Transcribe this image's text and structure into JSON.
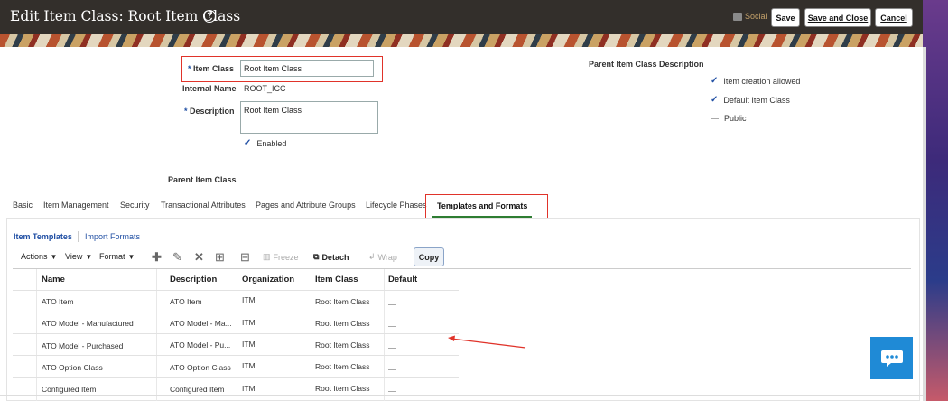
{
  "header": {
    "title": "Edit Item Class: Root Item Class",
    "help_icon": "?",
    "social_label": "Social",
    "buttons": {
      "save": "Save",
      "save_and_close": "Save and Close",
      "cancel": "Cancel"
    }
  },
  "form": {
    "item_class_label": "Item Class",
    "item_class_value": "Root Item Class",
    "internal_name_label": "Internal Name",
    "internal_name_value": "ROOT_ICC",
    "description_label": "Description",
    "description_value": "Root Item Class",
    "enabled_label": "Enabled",
    "parent_item_class_label": "Parent Item Class",
    "required_marker": "*"
  },
  "right_panel": {
    "parent_desc_label": "Parent Item Class Description",
    "options": [
      {
        "label": "Item creation allowed",
        "state": "checked"
      },
      {
        "label": "Default Item Class",
        "state": "checked"
      },
      {
        "label": "Public",
        "state": "unchecked"
      }
    ]
  },
  "tabs": [
    {
      "label": "Basic"
    },
    {
      "label": "Item Management"
    },
    {
      "label": "Security"
    },
    {
      "label": "Transactional Attributes"
    },
    {
      "label": "Pages and Attribute Groups"
    },
    {
      "label": "Lifecycle Phases"
    },
    {
      "label": "Templates and Formats"
    }
  ],
  "active_tab": "Templates and Formats",
  "subtabs": [
    {
      "label": "Item Templates"
    },
    {
      "label": "Import Formats"
    }
  ],
  "toolbar": {
    "actions": "Actions",
    "view": "View",
    "format": "Format",
    "freeze": "Freeze",
    "detach": "Detach",
    "wrap": "Wrap",
    "copy": "Copy"
  },
  "table": {
    "columns": [
      "Name",
      "Description",
      "Organization",
      "Item Class",
      "Default"
    ],
    "rows": [
      [
        "ATO Item",
        "ATO Item",
        "ITM",
        "Root Item Class"
      ],
      [
        "ATO Model - Manufactured",
        "ATO Model - Ma...",
        "ITM",
        "Root Item Class"
      ],
      [
        "ATO Model - Purchased",
        "ATO Model - Pu...",
        "ITM",
        "Root Item Class"
      ],
      [
        "ATO Option Class",
        "ATO Option Class",
        "ITM",
        "Root Item Class"
      ],
      [
        "Configured Item",
        "Configured Item",
        "ITM",
        "Root Item Class"
      ]
    ]
  },
  "colors": {
    "header_bg": "#332f2b",
    "accent_blue": "#1f4ea3",
    "highlight_red": "#e0332a",
    "tab_green": "#2e7d32",
    "chat_blue": "#1f8ad6"
  }
}
